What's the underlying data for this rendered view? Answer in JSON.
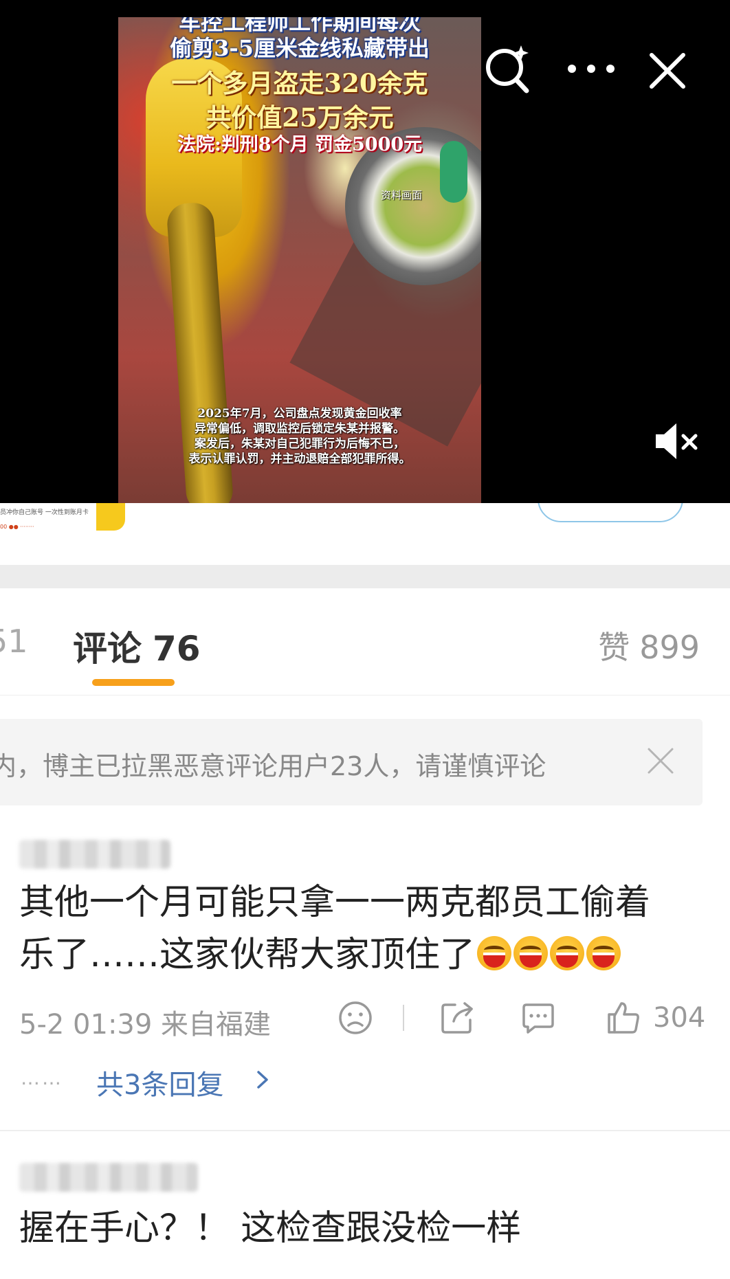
{
  "video": {
    "overlay_lines": [
      "车控工程师工作期间每次",
      "偷剪3-5厘米金线私藏带出",
      "一个多月盗走320余克",
      "共价值25万余元",
      "法院:判刑8个月  罚金5000元"
    ],
    "source_tag": "资料画面",
    "caption_lines": [
      "2025年7月，公司盘点发现黄金回收率",
      "异常偏低，调取监控后锁定朱某并报警。",
      "案发后，朱某对自己犯罪行为后悔不已，",
      "表示认罪认罚，并主动退赔全部犯罪所得。"
    ],
    "controls": {
      "search_icon": "search-sparkle-icon",
      "more_icon": "more-dots-icon",
      "close_icon": "close-icon",
      "mute_icon": "speaker-muted-icon"
    }
  },
  "ad": {
    "line1": "员冲你自己账号 一次性到账月卡",
    "line2": "00 ●● ········"
  },
  "tabs": {
    "partial_left": "51",
    "comments_label": "评论",
    "comments_count": "76",
    "likes_label": "赞",
    "likes_count": "899"
  },
  "notice": {
    "text": "内，博主已拉黑恶意评论用户23人，请谨慎评论"
  },
  "comments": [
    {
      "line1": "其他一个月可能只拿一一两克都员工偷着",
      "line2": "乐了……这家伙帮大家顶住了",
      "emoji_icon": "grinning-face-icon",
      "emoji_count": 4,
      "time": "5-2 01:39",
      "location": "来自福建",
      "like_count": "304",
      "replies_link": "共3条回复",
      "replies_dots": "……"
    },
    {
      "line1": "握在手心？！ 这检查跟没检一样"
    }
  ],
  "colors": {
    "tab_underline": "#f7a01b",
    "link_blue": "#4a76b4",
    "meta_gray": "#999999"
  }
}
